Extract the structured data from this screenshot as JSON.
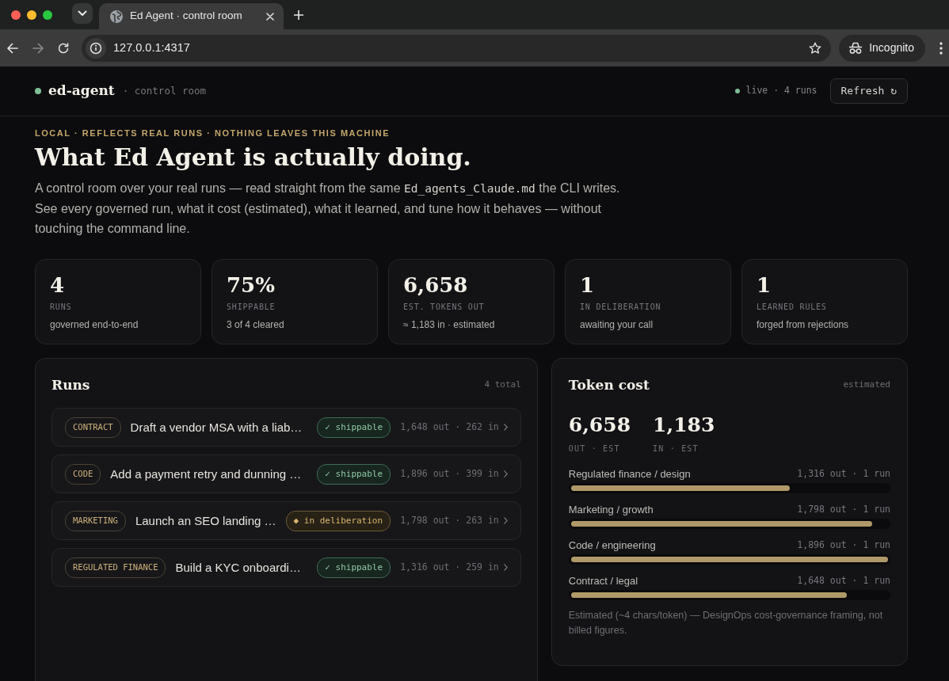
{
  "browser": {
    "tabs": [
      {
        "title": "Ed Agent · control room",
        "selected": true
      }
    ],
    "url": "127.0.0.1:4317",
    "forward_disabled": true,
    "profile": "Incognito"
  },
  "header": {
    "brand": "ed-agent",
    "subtitle": "· control room",
    "status": "live · 4 runs",
    "refresh": "Refresh ↻"
  },
  "hero": {
    "eyebrow": "LOCAL · REFLECTS REAL RUNS · NOTHING LEAVES THIS MACHINE",
    "title": "What Ed Agent is actually doing.",
    "intro": {
      "before": "A control room over your real runs — read straight from the same ",
      "file": "Ed_agents_Claude.md",
      "after": " the CLI writes. See every governed run, what it cost (estimated), what it learned, and tune how it behaves — without touching the command line."
    }
  },
  "stats": [
    {
      "value": "4",
      "label": "RUNS",
      "note": "governed end-to-end"
    },
    {
      "value": "75%",
      "label": "SHIPPABLE",
      "note": "3 of 4 cleared"
    },
    {
      "value": "6,658",
      "label": "EST. TOKENS OUT",
      "note": "≈ 1,183 in · estimated"
    },
    {
      "value": "1",
      "label": "IN DELIBERATION",
      "note": "awaiting your call"
    },
    {
      "value": "1",
      "label": "LEARNED RULES",
      "note": "forged from rejections"
    }
  ],
  "runs": {
    "title": "Runs",
    "count": "4 total",
    "items": [
      {
        "tag": "CONTRACT",
        "title": "Draft a vendor MSA with a liab…",
        "status": {
          "kind": "shippable",
          "label": "✓ shippable"
        },
        "tokens": "1,648 out · 262 in"
      },
      {
        "tag": "CODE",
        "title": "Add a payment retry and dunning …",
        "status": {
          "kind": "shippable",
          "label": "✓ shippable"
        },
        "tokens": "1,896 out · 399 in"
      },
      {
        "tag": "MARKETING",
        "title": "Launch an SEO landing …",
        "status": {
          "kind": "deliberation",
          "label": "◆ in deliberation"
        },
        "tokens": "1,798 out · 263 in"
      },
      {
        "tag": "REGULATED FINANCE",
        "title": "Build a KYC onboardi…",
        "status": {
          "kind": "shippable",
          "label": "✓ shippable"
        },
        "tokens": "1,316 out · 259 in"
      }
    ]
  },
  "token_cost": {
    "title": "Token cost",
    "badge": "estimated",
    "totals": [
      {
        "value": "6,658",
        "label": "OUT · EST"
      },
      {
        "value": "1,183",
        "label": "IN · EST"
      }
    ],
    "categories": [
      {
        "name": "Regulated finance / design",
        "reading": "1,316 out · 1 run",
        "level": 0.69
      },
      {
        "name": "Marketing / growth",
        "reading": "1,798 out · 1 run",
        "level": 0.95
      },
      {
        "name": "Code / engineering",
        "reading": "1,896 out · 1 run",
        "level": 1
      },
      {
        "name": "Contract / legal",
        "reading": "1,648 out · 1 run",
        "level": 0.87
      }
    ],
    "footnote": "Estimated (~4 chars/token) — DesignOps cost-governance framing, not billed figures."
  }
}
